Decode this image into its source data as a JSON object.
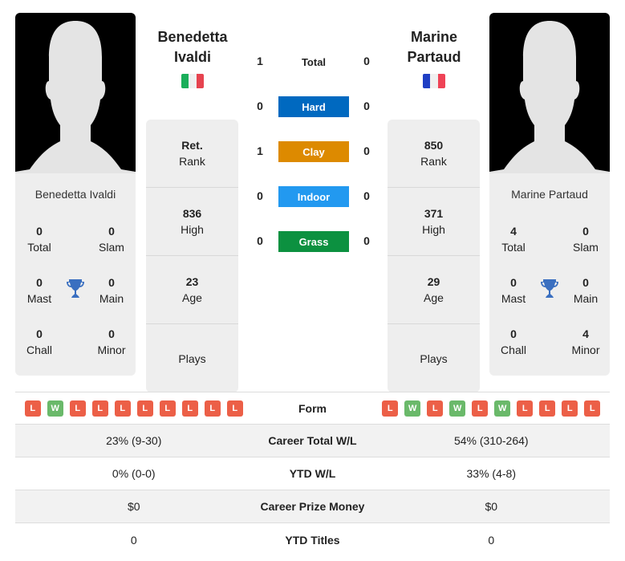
{
  "colors": {
    "hard": "#0069c0",
    "clay": "#dd8a00",
    "indoor": "#2299f0",
    "grass": "#0c9140",
    "loss": "#ec5f47",
    "win": "#6ab96a",
    "trophy": "#3a6fc0"
  },
  "player1": {
    "name_line1": "Benedetta",
    "name_line2": "Ivaldi",
    "full_name": "Benedetta Ivaldi",
    "flag": [
      "#1aae5a",
      "#f0f0f0",
      "#e6434f"
    ],
    "titles": {
      "total": {
        "value": "0",
        "label": "Total"
      },
      "slam": {
        "value": "0",
        "label": "Slam"
      },
      "mast": {
        "value": "0",
        "label": "Mast"
      },
      "main": {
        "value": "0",
        "label": "Main"
      },
      "chall": {
        "value": "0",
        "label": "Chall"
      },
      "minor": {
        "value": "0",
        "label": "Minor"
      }
    },
    "rank": {
      "value": "Ret.",
      "label": "Rank"
    },
    "high": {
      "value": "836",
      "label": "High"
    },
    "age": {
      "value": "23",
      "label": "Age"
    },
    "plays": {
      "value": "",
      "label": "Plays"
    },
    "form": [
      "L",
      "W",
      "L",
      "L",
      "L",
      "L",
      "L",
      "L",
      "L",
      "L"
    ],
    "career_wl": "23% (9-30)",
    "ytd_wl": "0% (0-0)",
    "prize": "$0",
    "ytd_titles": "0"
  },
  "player2": {
    "name_line1": "Marine",
    "name_line2": "Partaud",
    "full_name": "Marine Partaud",
    "flag": [
      "#1f3fc4",
      "#f0f0f0",
      "#ef4356"
    ],
    "titles": {
      "total": {
        "value": "4",
        "label": "Total"
      },
      "slam": {
        "value": "0",
        "label": "Slam"
      },
      "mast": {
        "value": "0",
        "label": "Mast"
      },
      "main": {
        "value": "0",
        "label": "Main"
      },
      "chall": {
        "value": "0",
        "label": "Chall"
      },
      "minor": {
        "value": "4",
        "label": "Minor"
      }
    },
    "rank": {
      "value": "850",
      "label": "Rank"
    },
    "high": {
      "value": "371",
      "label": "High"
    },
    "age": {
      "value": "29",
      "label": "Age"
    },
    "plays": {
      "value": "",
      "label": "Plays"
    },
    "form": [
      "L",
      "W",
      "L",
      "W",
      "L",
      "W",
      "L",
      "L",
      "L",
      "L"
    ],
    "career_wl": "54% (310-264)",
    "ytd_wl": "33% (4-8)",
    "prize": "$0",
    "ytd_titles": "0"
  },
  "h2h": [
    {
      "label": "Total",
      "p1": "1",
      "p2": "0",
      "type": "plain"
    },
    {
      "label": "Hard",
      "p1": "0",
      "p2": "0",
      "type": "hard"
    },
    {
      "label": "Clay",
      "p1": "1",
      "p2": "0",
      "type": "clay"
    },
    {
      "label": "Indoor",
      "p1": "0",
      "p2": "0",
      "type": "indoor"
    },
    {
      "label": "Grass",
      "p1": "0",
      "p2": "0",
      "type": "grass"
    }
  ],
  "table": {
    "form_label": "Form",
    "career_wl_label": "Career Total W/L",
    "ytd_wl_label": "YTD W/L",
    "prize_label": "Career Prize Money",
    "ytd_titles_label": "YTD Titles"
  }
}
